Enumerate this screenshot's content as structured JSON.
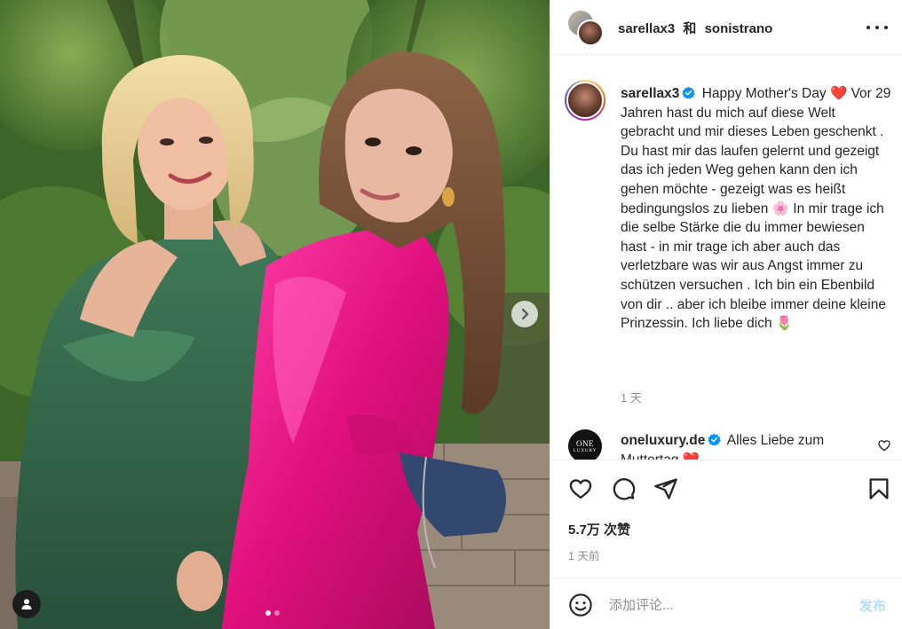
{
  "photo": {
    "carousel_total": 2,
    "carousel_active": 1,
    "next_icon": "chevron-right-icon",
    "tag_icon": "person-icon"
  },
  "header": {
    "user1": "sarellax3",
    "joiner": "和",
    "user2": "sonistrano",
    "more_icon": "more-horizontal-icon"
  },
  "caption": {
    "username": "sarellax3",
    "verified_icon": "verified-badge-icon",
    "seg1": "Happy Mother's Day",
    "emoji1": "❤️",
    "seg2": "Vor 29 Jahren hast du mich auf diese Welt gebracht und mir dieses Leben geschenkt . Du hast mir das laufen gelernt und gezeigt",
    "seg3": "das ich jeden Weg gehen kann den ich gehen möchte - gezeigt was es heißt bedingungslos zu lieben",
    "emoji2": "🌸",
    "seg4": "In mir trage ich die selbe Stärke die du immer bewiesen hast - in mir trage ich aber auch das verletzbare was wir aus Angst immer zu schützen versuchen . Ich bin ein Ebenbild von dir .. aber ich bleibe immer deine kleine Prinzessin. Ich liebe dich",
    "emoji3": "🌷",
    "time": "1 天"
  },
  "comment": {
    "avatar_text": "ONE",
    "avatar_sub": "LUXURY",
    "username": "oneluxury.de",
    "text": "Alles Liebe zum Muttertag",
    "emoji": "❤️",
    "like_icon": "heart-outline-icon"
  },
  "actions": {
    "like_icon": "heart-icon",
    "comment_icon": "comment-icon",
    "share_icon": "send-icon",
    "save_icon": "bookmark-icon",
    "likes": "5.7万 次赞",
    "date": "1 天前"
  },
  "add_comment": {
    "emoji_icon": "smiley-icon",
    "placeholder": "添加评论...",
    "post_label": "发布"
  },
  "colors": {
    "verified": "#0095f6",
    "post_disabled": "#b2dffc",
    "secondary_text": "#8e8e8e"
  }
}
